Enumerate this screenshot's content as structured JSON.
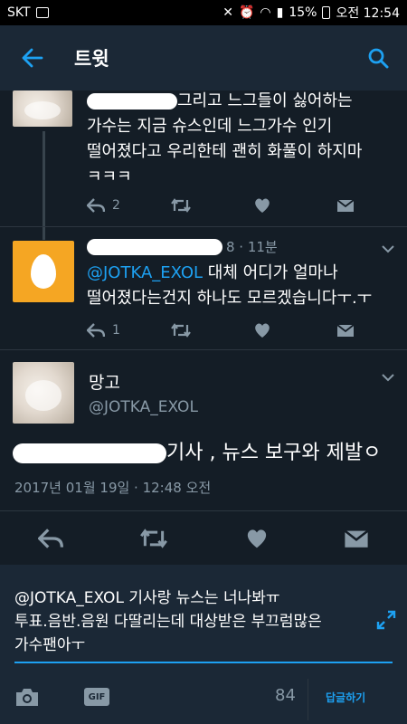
{
  "status": {
    "carrier": "SKT",
    "battery": "15%",
    "time": "오전 12:54"
  },
  "appbar": {
    "title": "트윗"
  },
  "tweet1": {
    "line1_rest": "그리고 느그들이 싫어하는",
    "line2": "가수는 지금 슈스인데 느그가수 인기",
    "line3": "떨어졌다고 우리한테 괜히 화풀이 하지마",
    "line4": "ㅋㅋㅋ",
    "reply_count": "2"
  },
  "tweet2": {
    "meta": "8 · 11분",
    "mention": "@JOTKA_EXOL",
    "line1_rest": " 대체 어디가 얼마나",
    "line2": "떨어졌다는건지 하나도 모르겠습니다ㅜ.ㅜ",
    "reply_count": "1"
  },
  "main_tweet": {
    "name": "망고",
    "handle": "@JOTKA_EXOL",
    "text_rest": "기사 , 뉴스 보구와 제발ㅇ",
    "timestamp": "2017년 01월 19일 · 12:48 오전"
  },
  "reply": {
    "mention": "@JOTKA_EXOL",
    "line1_rest": " 기사랑 뉴스는 너나봐ㅠ",
    "line2": "투표.음반.음원 다딸리는데 대상받은 부끄럼많은",
    "line3": "가수팬아ㅜ",
    "gif_label": "GIF",
    "char_count": "84",
    "submit_label": "답글하기"
  },
  "colors": {
    "background": "#141d26",
    "bar": "#1b2836",
    "accent": "#1da1f2",
    "secondary_text": "#8899a6"
  }
}
